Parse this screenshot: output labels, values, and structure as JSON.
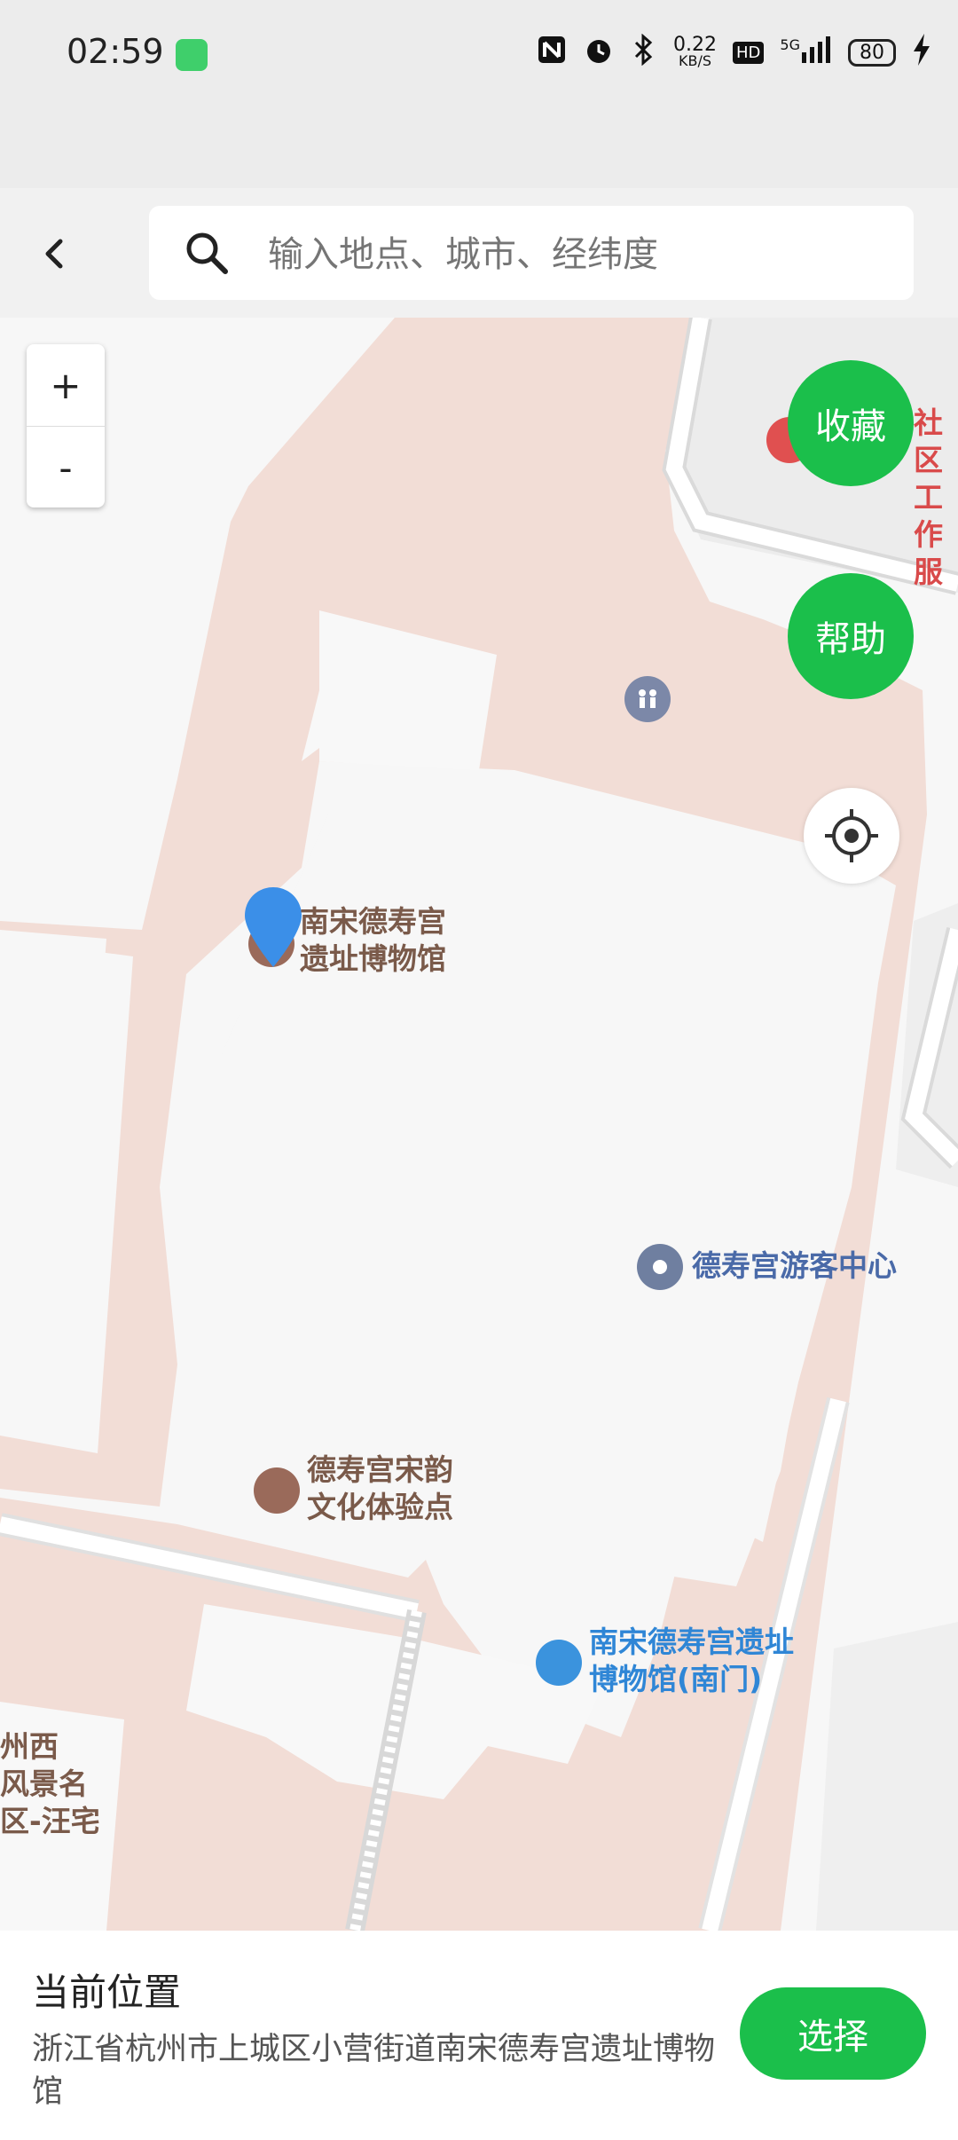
{
  "status_bar": {
    "time": "02:59",
    "net_speed_value": "0.22",
    "net_speed_unit": "KB/S",
    "hd": "HD",
    "network": "5G",
    "battery": "80"
  },
  "search": {
    "placeholder": "输入地点、城市、经纬度"
  },
  "map": {
    "zoom_in": "+",
    "zoom_out": "-",
    "favorite_label": "收藏",
    "help_label": "帮助",
    "labels": {
      "community": [
        "社区",
        "工作服"
      ],
      "museum": [
        "南宋德寿宫",
        "遗址博物馆"
      ],
      "visitor_center": "德寿宫游客中心",
      "culture_point": [
        "德寿宫宋韵",
        "文化体验点"
      ],
      "south_gate": [
        "南宋德寿宫遗址",
        "博物馆(南门)"
      ],
      "scenic_area": [
        "州西",
        "风景名",
        "区-汪宅"
      ]
    }
  },
  "bottom": {
    "title": "当前位置",
    "address": "浙江省杭州市上城区小营街道南宋德寿宫遗址博物馆",
    "select_label": "选择"
  },
  "colors": {
    "accent_green": "#1bbf4b",
    "map_area": "#f2ddd6",
    "pin_blue": "#3b8fe8"
  }
}
